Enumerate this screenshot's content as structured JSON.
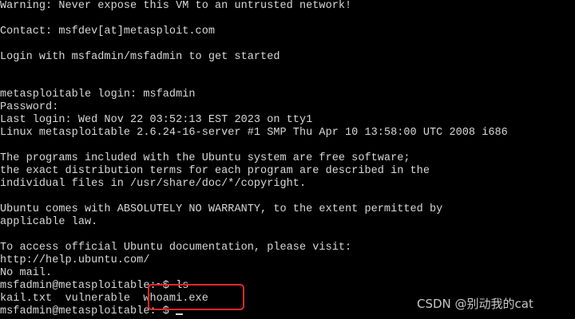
{
  "terminal": {
    "lines": [
      "Warning: Never expose this VM to an untrusted network!",
      "",
      "Contact: msfdev[at]metasploit.com",
      "",
      "Login with msfadmin/msfadmin to get started",
      "",
      "",
      "metasploitable login: msfadmin",
      "Password:",
      "Last login: Wed Nov 22 03:52:13 EST 2023 on tty1",
      "Linux metasploitable 2.6.24-16-server #1 SMP Thu Apr 10 13:58:00 UTC 2008 i686",
      "",
      "The programs included with the Ubuntu system are free software;",
      "the exact distribution terms for each program are described in the",
      "individual files in /usr/share/doc/*/copyright.",
      "",
      "Ubuntu comes with ABSOLUTELY NO WARRANTY, to the extent permitted by",
      "applicable law.",
      "",
      "To access official Ubuntu documentation, please visit:",
      "http://help.ubuntu.com/",
      "No mail.",
      "msfadmin@metasploitable:~$ ls",
      "kail.txt  vulnerable  whoami.exe",
      "msfadmin@metasploitable:~$ "
    ],
    "text_color": "#d8d8d8",
    "background": "#000000"
  },
  "annotation": {
    "color": "#e8262c"
  },
  "watermark": {
    "text": "CSDN @别动我的cat"
  }
}
